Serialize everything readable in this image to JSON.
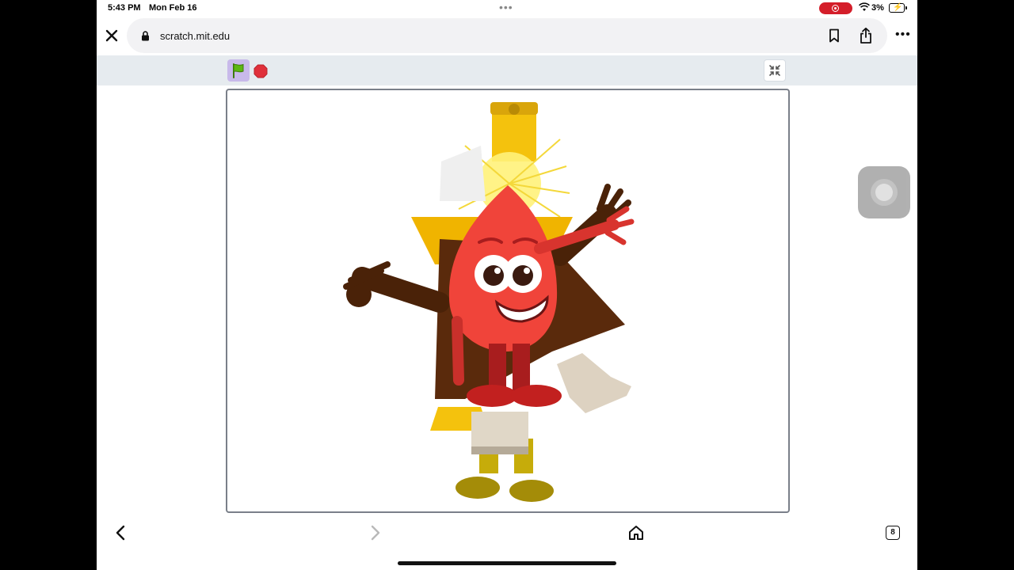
{
  "status": {
    "time": "5:43 PM",
    "date": "Mon Feb 16",
    "battery": "3%"
  },
  "browser": {
    "url": "scratch.mit.edu",
    "open_tabs": "8"
  },
  "colors": {
    "accent_flag": "#5cb712",
    "stop": "#e0303a",
    "record": "#d41e2a"
  },
  "icons": {
    "close": "close-icon",
    "lock": "lock-icon",
    "bookmark": "bookmark-icon",
    "share": "share-icon",
    "more": "more-icon",
    "flag": "green-flag-icon",
    "stop": "stop-icon",
    "fullscreen": "exit-fullscreen-icon",
    "back": "chevron-left-icon",
    "forward": "chevron-right-icon",
    "home": "home-icon",
    "tabs": "tabs-icon"
  }
}
